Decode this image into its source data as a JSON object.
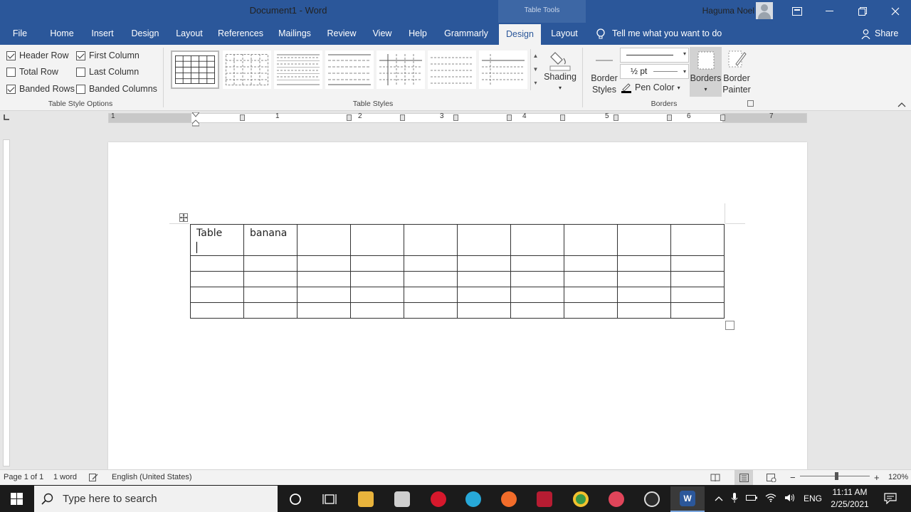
{
  "titlebar": {
    "document_title": "Document1  -  Word",
    "context_label": "Table Tools",
    "user_name": "Haguma Noel"
  },
  "tabs": [
    "File",
    "Home",
    "Insert",
    "Design",
    "Layout",
    "References",
    "Mailings",
    "Review",
    "View",
    "Help",
    "Grammarly",
    "Design",
    "Layout"
  ],
  "active_tab_index": 11,
  "tell_me": "Tell me what you want to do",
  "share": "Share",
  "ribbon": {
    "style_options": {
      "header_row": "Header Row",
      "total_row": "Total Row",
      "banded_rows": "Banded Rows",
      "first_column": "First Column",
      "last_column": "Last Column",
      "banded_columns": "Banded Columns",
      "checked": {
        "header_row": true,
        "total_row": false,
        "banded_rows": true,
        "first_column": true,
        "last_column": false,
        "banded_columns": false
      },
      "group_label": "Table Style Options"
    },
    "table_styles": {
      "group_label": "Table Styles"
    },
    "shading": "Shading",
    "borders": {
      "border_styles_1": "Border",
      "border_styles_2": "Styles",
      "pen_weight": "½ pt",
      "pen_color": "Pen Color",
      "borders_btn": "Borders",
      "painter_1": "Border",
      "painter_2": "Painter",
      "group_label": "Borders",
      "pen_color_hex": "#000000"
    }
  },
  "ruler": {
    "numbers": [
      "1",
      "1",
      "2",
      "3",
      "4",
      "5",
      "6",
      "7"
    ]
  },
  "document": {
    "table": {
      "rows": [
        [
          "Table",
          "banana",
          "",
          "",
          "",
          "",
          "",
          "",
          "",
          ""
        ],
        [
          "",
          "",
          "",
          "",
          "",
          "",
          "",
          "",
          "",
          ""
        ],
        [
          "",
          "",
          "",
          "",
          "",
          "",
          "",
          "",
          "",
          ""
        ],
        [
          "",
          "",
          "",
          "",
          "",
          "",
          "",
          "",
          "",
          ""
        ],
        [
          "",
          "",
          "",
          "",
          "",
          "",
          "",
          "",
          "",
          ""
        ]
      ]
    }
  },
  "statusbar": {
    "page": "Page 1 of 1",
    "words": "1 word",
    "language": "English (United States)",
    "zoom": "120%"
  },
  "taskbar": {
    "search_placeholder": "Type here to search",
    "language": "ENG",
    "time": "11:11 AM",
    "date": "2/25/2021"
  },
  "colors": {
    "word_blue": "#2b579a",
    "context_tab": "#3d67a5",
    "taskbar": "#1b1b1b"
  }
}
